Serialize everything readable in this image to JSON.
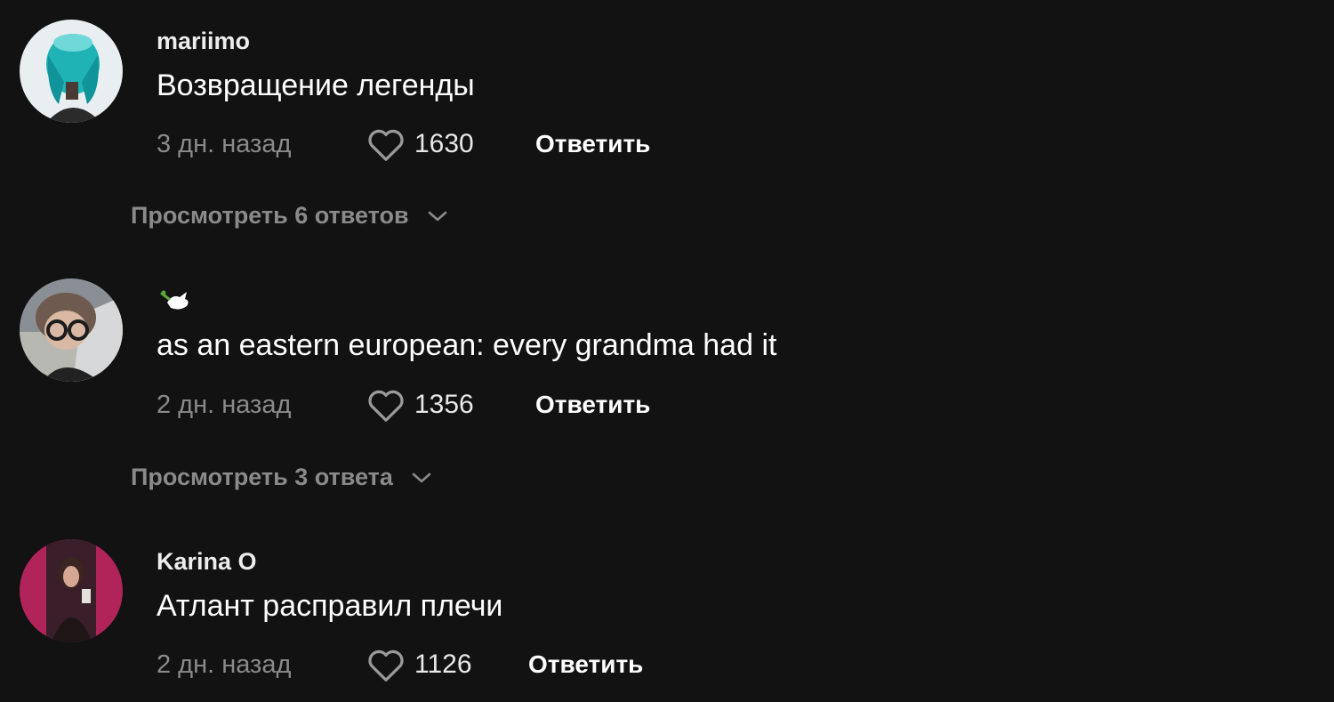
{
  "comments": [
    {
      "username": "mariimo",
      "text": "Возвращение легенды",
      "time": "3 дн. назад",
      "likes": "1630",
      "reply_label": "Ответить",
      "view_replies": "Просмотреть 6 ответов"
    },
    {
      "username": "",
      "badge_icon": "dove-with-olive-branch",
      "text": "as an eastern european: every grandma had it",
      "time": "2 дн. назад",
      "likes": "1356",
      "reply_label": "Ответить",
      "view_replies": "Просмотреть 3 ответа"
    },
    {
      "username": "Karina O",
      "text": "Атлант расправил плечи",
      "time": "2 дн. назад",
      "likes": "1126",
      "reply_label": "Ответить"
    }
  ],
  "colors": {
    "background": "#121212",
    "muted_text": "#8a8a8a",
    "primary_text": "#ffffff"
  }
}
